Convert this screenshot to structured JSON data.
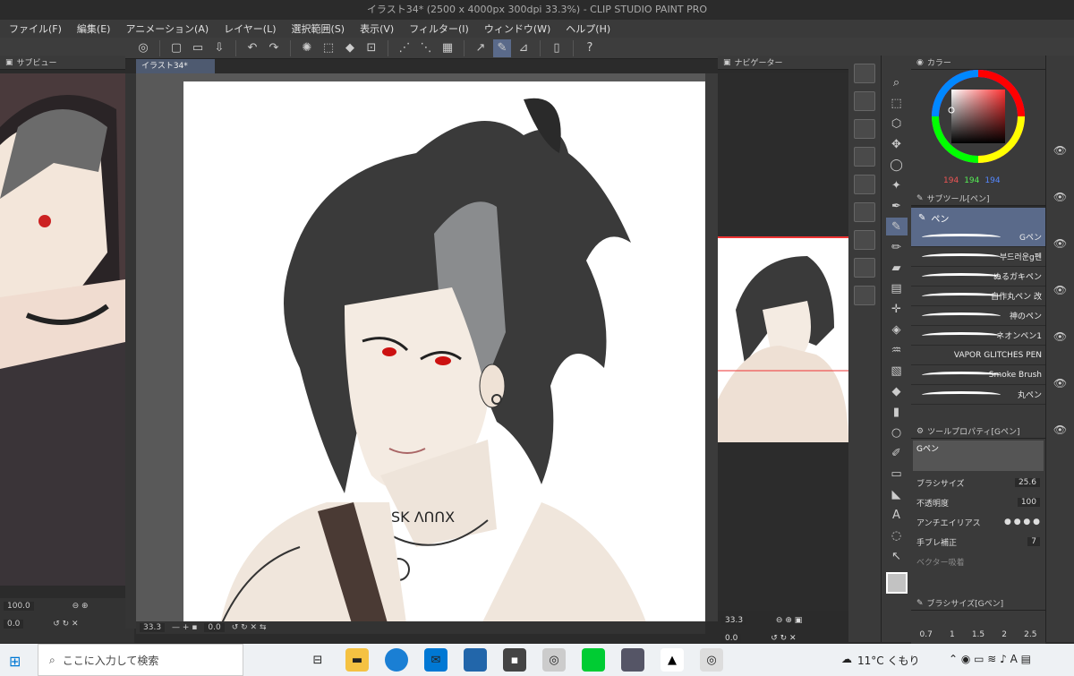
{
  "window": {
    "title": "イラスト34* (2500 x 4000px 300dpi 33.3%) - CLIP STUDIO PAINT PRO"
  },
  "menu": [
    "ファイル(F)",
    "編集(E)",
    "アニメーション(A)",
    "レイヤー(L)",
    "選択範囲(S)",
    "表示(V)",
    "フィルター(I)",
    "ウィンドウ(W)",
    "ヘルプ(H)"
  ],
  "panels": {
    "subview_title": "サブビュー",
    "canvas_tab": "イラスト34*",
    "navigator_title": "ナビゲーター",
    "color_title": "カラー",
    "subtool_title": "サブツール[ペン]",
    "subtool_group": "ペン",
    "toolprop_title": "ツールプロパティ[Gペン]",
    "toolprop_brush": "Gペン",
    "brushsize_title": "ブラシサイズ[Gペン]"
  },
  "color": {
    "r": "194",
    "g": "194",
    "b": "194",
    "main": "#c2c2c2"
  },
  "brushes": [
    "Gペン",
    "부드러운g펜",
    "ぬるガキペン",
    "自作丸ペン 改",
    "神のペン",
    "ネオンペン1",
    "VAPOR GLITCHES PEN",
    "Smoke Brush",
    "丸ペン"
  ],
  "props": {
    "brush_size_label": "ブラシサイズ",
    "brush_size": "25.6",
    "opacity_label": "不透明度",
    "opacity": "100",
    "antialias_label": "アンチエイリアス",
    "stabilization_label": "手ブレ補正",
    "stabilization": "7",
    "vector_label": "ベクター吸着"
  },
  "brush_sizes": [
    "0.7",
    "1",
    "1.5",
    "2",
    "2.5"
  ],
  "subview": {
    "zoom": "100.0",
    "rotate": "0.0"
  },
  "status": {
    "zoom": "33.3",
    "rotate": "0.0"
  },
  "navigator": {
    "zoom": "33.3",
    "rotate": "0.0"
  },
  "taskbar": {
    "search_placeholder": "ここに入力して検索",
    "weather": "11°C くもり"
  }
}
